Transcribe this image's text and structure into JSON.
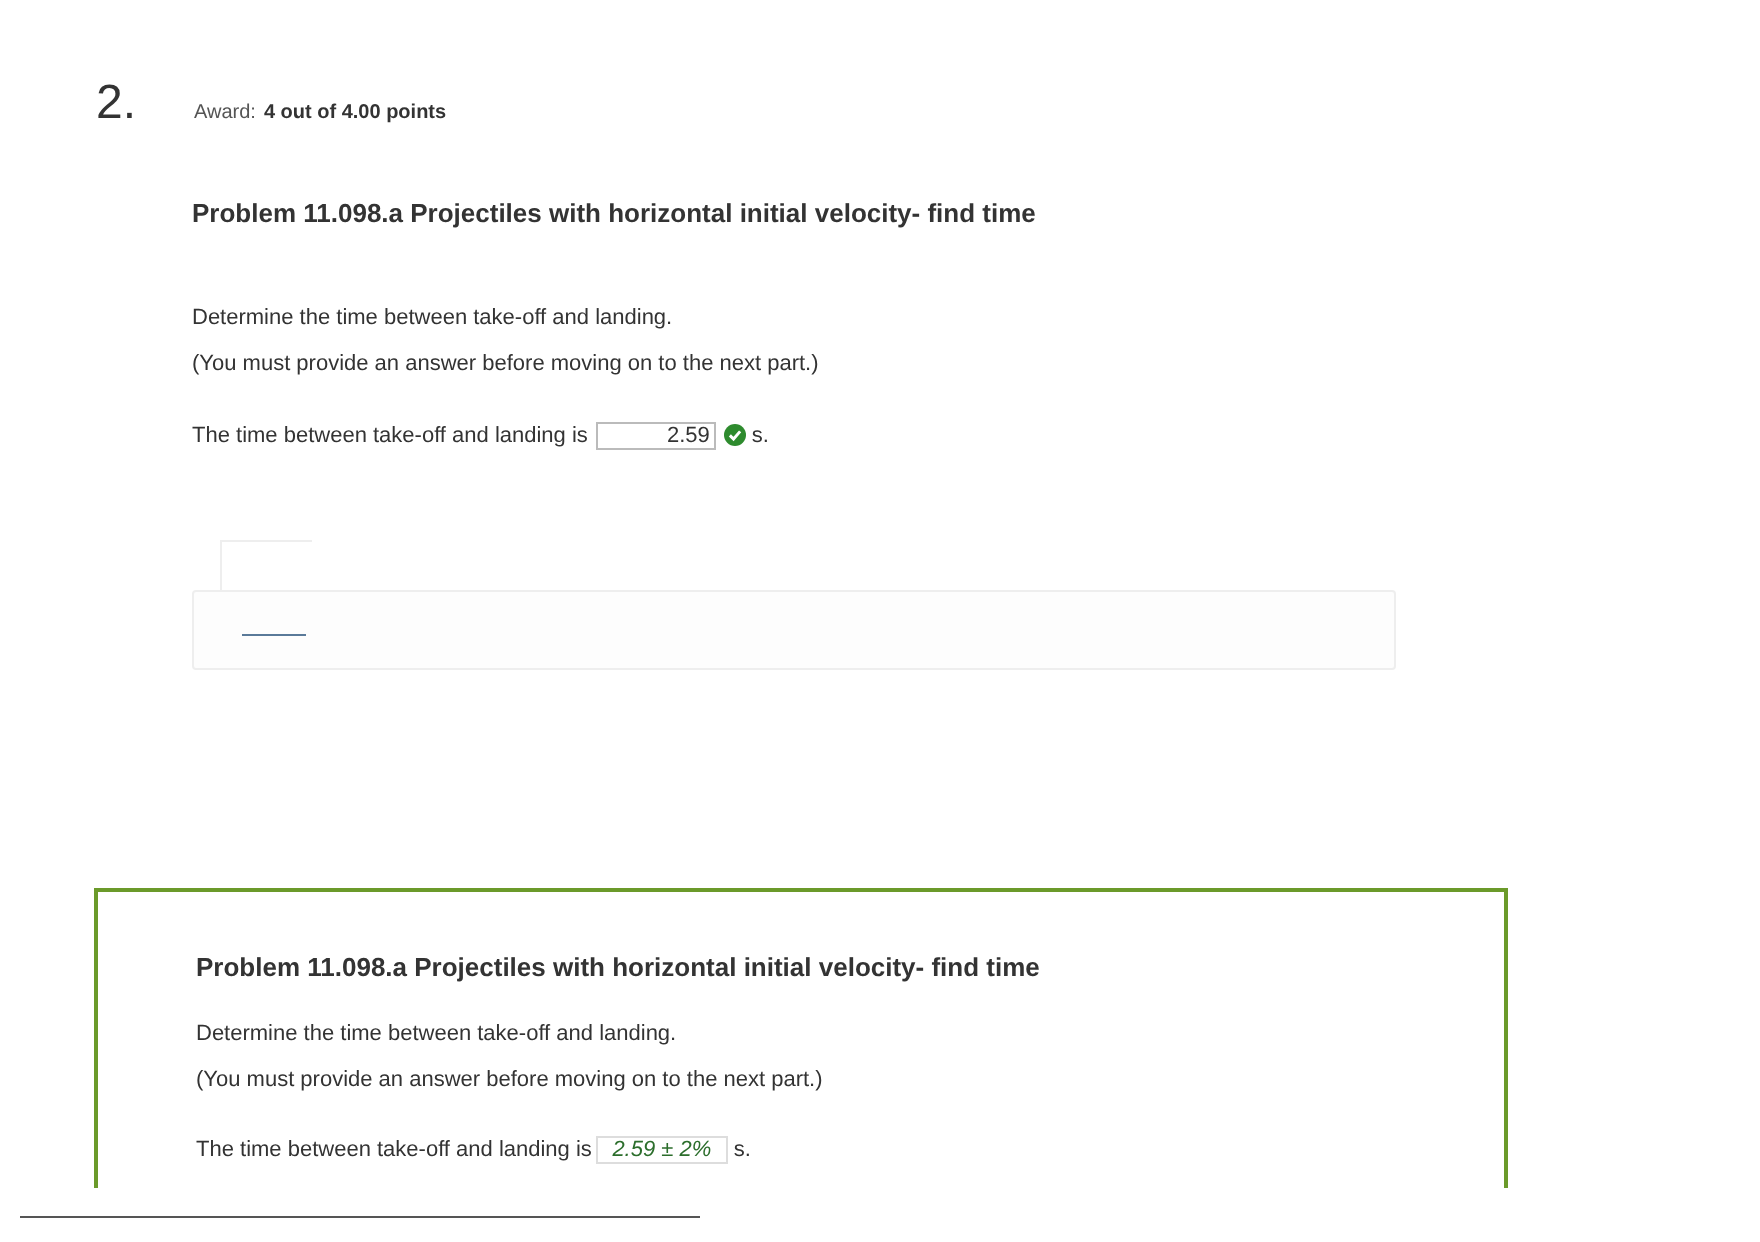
{
  "question": {
    "number": "2.",
    "award_label": "Award:",
    "award_value": "4 out of 4.00 points"
  },
  "attempt": {
    "title": "Problem 11.098.a Projectiles with horizontal initial velocity- find time",
    "prompt": "Determine the time between take-off and landing.",
    "note": "(You must provide an answer before moving on to the next part.)",
    "answer_label": "The time between take-off and landing is",
    "answer_value": "2.59",
    "correct": true,
    "unit": "s."
  },
  "solution": {
    "title": "Problem 11.098.a Projectiles with horizontal initial velocity- find time",
    "prompt": "Determine the time between take-off and landing.",
    "note": "(You must provide an answer before moving on to the next part.)",
    "answer_label": "The time between take-off and landing is",
    "answer_value": "2.59 ± 2%",
    "unit": "s."
  }
}
